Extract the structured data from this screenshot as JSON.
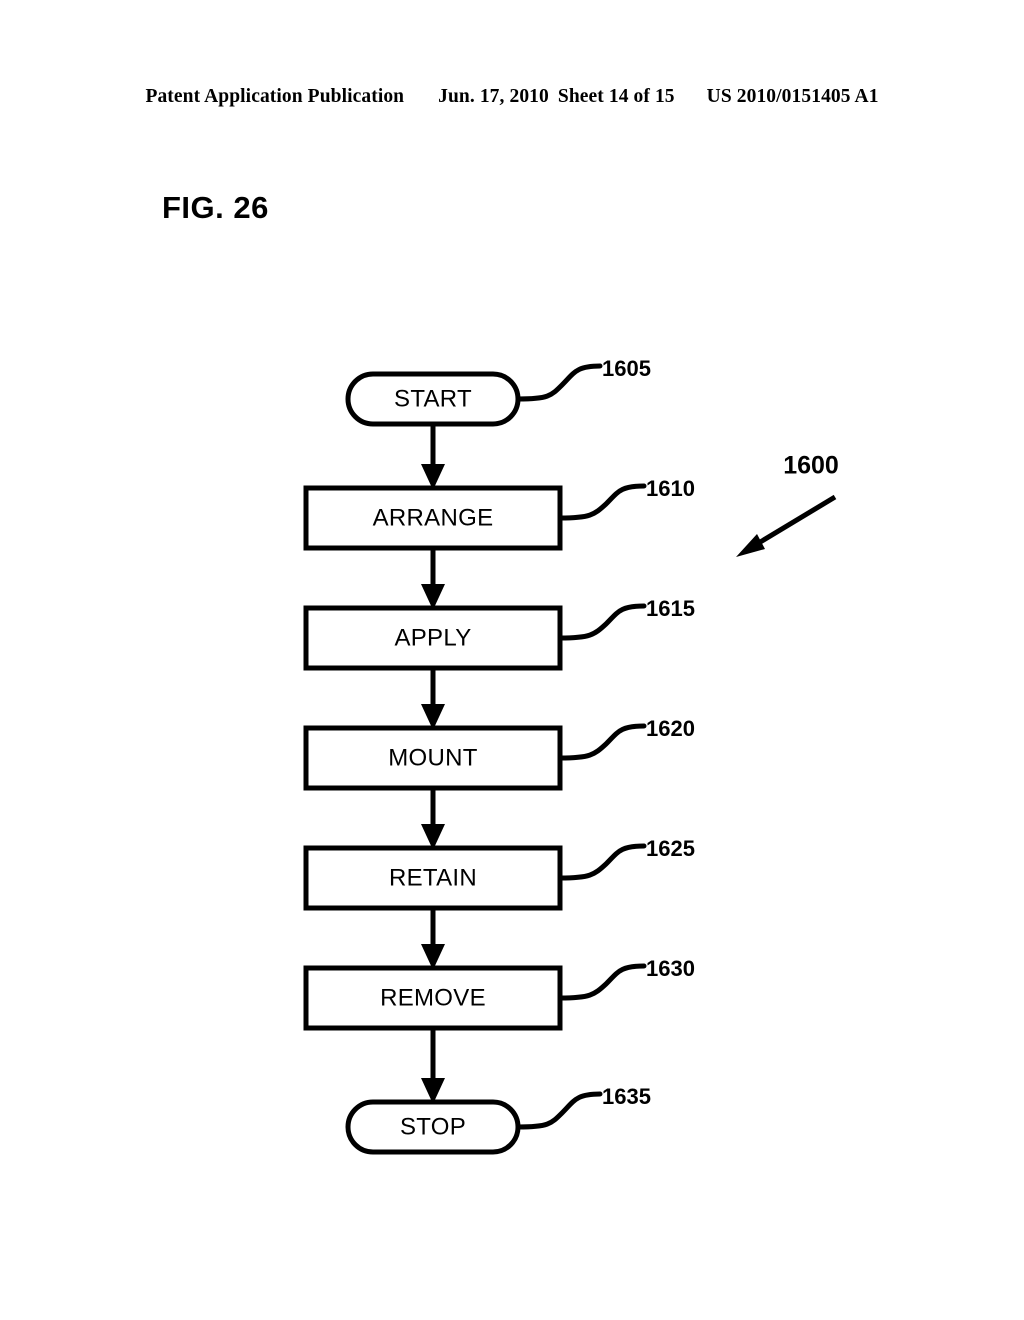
{
  "header": {
    "publication": "Patent Application Publication",
    "date": "Jun. 17, 2010",
    "sheet": "Sheet 14 of 15",
    "patent_number": "US 2010/0151405 A1"
  },
  "figure": {
    "label": "FIG. 26",
    "overall_ref": "1600"
  },
  "flowchart": {
    "nodes": [
      {
        "id": "start",
        "label": "START",
        "shape": "stadium",
        "ref": "1605"
      },
      {
        "id": "arrange",
        "label": "ARRANGE",
        "shape": "rect",
        "ref": "1610"
      },
      {
        "id": "apply",
        "label": "APPLY",
        "shape": "rect",
        "ref": "1615"
      },
      {
        "id": "mount",
        "label": "MOUNT",
        "shape": "rect",
        "ref": "1620"
      },
      {
        "id": "retain",
        "label": "RETAIN",
        "shape": "rect",
        "ref": "1625"
      },
      {
        "id": "remove",
        "label": "REMOVE",
        "shape": "rect",
        "ref": "1630"
      },
      {
        "id": "stop",
        "label": "STOP",
        "shape": "stadium",
        "ref": "1635"
      }
    ],
    "edges": [
      {
        "from": "start",
        "to": "arrange"
      },
      {
        "from": "arrange",
        "to": "apply"
      },
      {
        "from": "apply",
        "to": "mount"
      },
      {
        "from": "mount",
        "to": "retain"
      },
      {
        "from": "retain",
        "to": "remove"
      },
      {
        "from": "remove",
        "to": "stop"
      }
    ],
    "colors": {
      "stroke": "#000000",
      "fill": "#ffffff"
    }
  }
}
